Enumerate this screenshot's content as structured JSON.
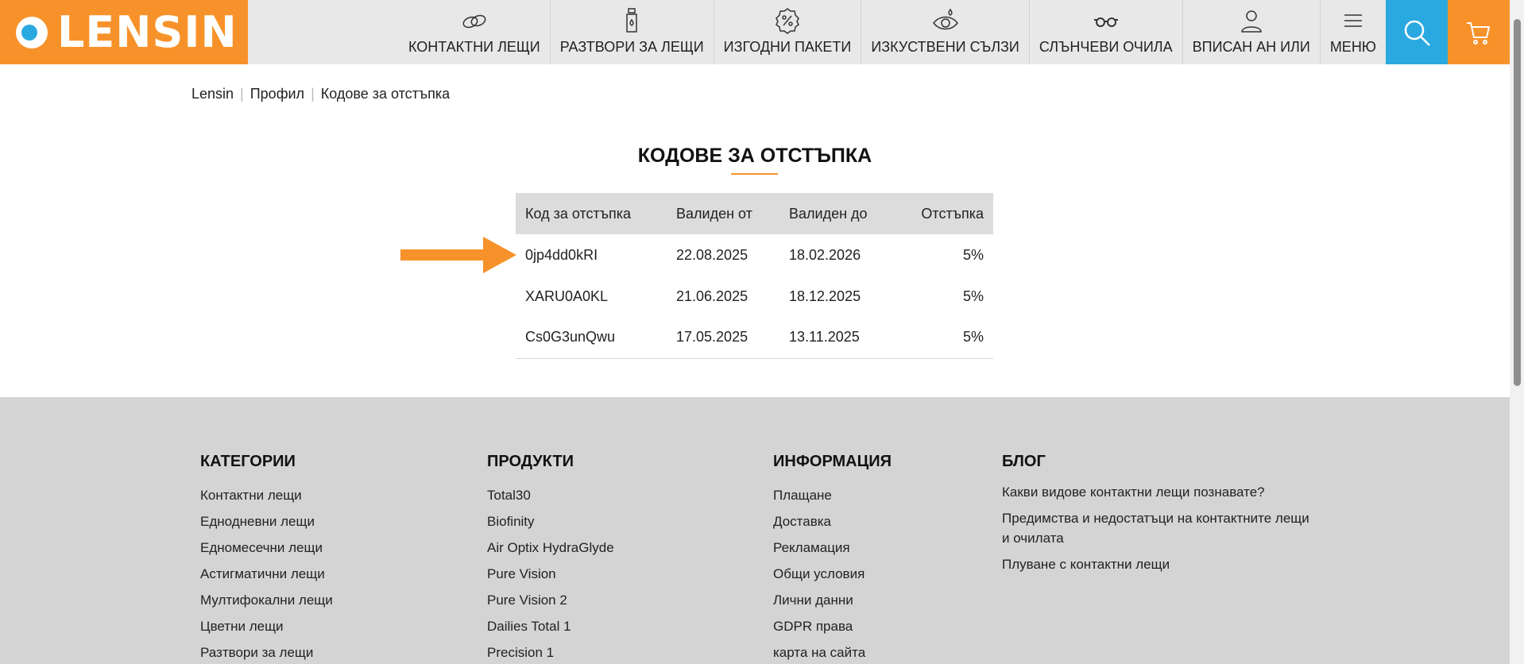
{
  "header": {
    "logo_text": "LENSIN",
    "nav": [
      {
        "label": "КОНТАКТНИ ЛЕЩИ",
        "icon": "contact-lenses-icon"
      },
      {
        "label": "РАЗТВОРИ ЗА ЛЕЩИ",
        "icon": "solution-bottle-icon"
      },
      {
        "label": "ИЗГОДНИ ПАКЕТИ",
        "icon": "discount-badge-icon"
      },
      {
        "label": "ИЗКУСТВЕНИ СЪЛЗИ",
        "icon": "eye-drop-icon"
      },
      {
        "label": "СЛЪНЧЕВИ ОЧИЛА",
        "icon": "sunglasses-icon"
      },
      {
        "label": "ВПИСАН АН ИЛИ",
        "icon": "user-icon"
      },
      {
        "label": "МЕНЮ",
        "icon": "hamburger-icon"
      }
    ],
    "search_icon": "search-icon",
    "cart_icon": "cart-icon"
  },
  "colors": {
    "brand_orange": "#f7922a",
    "accent_blue": "#2aa9e0",
    "footer_bg": "#d4d4d4"
  },
  "breadcrumb": [
    "Lensin",
    "Профил",
    "Кодове за отстъпка"
  ],
  "page_title": "КОДОВЕ ЗА ОТСТЪПКА",
  "table": {
    "headers": [
      "Код за отстъпка",
      "Валиден от",
      "Валиден до",
      "Отстъпка"
    ],
    "rows": [
      {
        "code": "0jp4dd0kRI",
        "from": "22.08.2025",
        "to": "18.02.2026",
        "discount": "5%"
      },
      {
        "code": "XARU0A0KL",
        "from": "21.06.2025",
        "to": "18.12.2025",
        "discount": "5%"
      },
      {
        "code": "Cs0G3unQwu",
        "from": "17.05.2025",
        "to": "13.11.2025",
        "discount": "5%"
      }
    ]
  },
  "footer": {
    "categories": {
      "title": "КАТЕГОРИИ",
      "links": [
        "Контактни лещи",
        "Еднодневни лещи",
        "Едномесечни лещи",
        "Астигматични лещи",
        "Мултифокални лещи",
        "Цветни лещи",
        "Разтвори за лещи"
      ]
    },
    "products": {
      "title": "ПРОДУКТИ",
      "links": [
        "Total30",
        "Biofinity",
        "Air Optix HydraGlyde",
        "Pure Vision",
        "Pure Vision 2",
        "Dailies Total 1",
        "Precision 1"
      ]
    },
    "information": {
      "title": "ИНФОРМАЦИЯ",
      "links": [
        "Плащане",
        "Доставка",
        "Рекламация",
        "Общи условия",
        "Лични данни",
        "GDPR права",
        "карта на сайта"
      ]
    },
    "blog": {
      "title": "БЛОГ",
      "links": [
        "Какви видове контактни лещи познавате?",
        "Предимства и недостатъци на контактните лещи и очилата",
        "Плуване с контактни лещи"
      ]
    }
  }
}
